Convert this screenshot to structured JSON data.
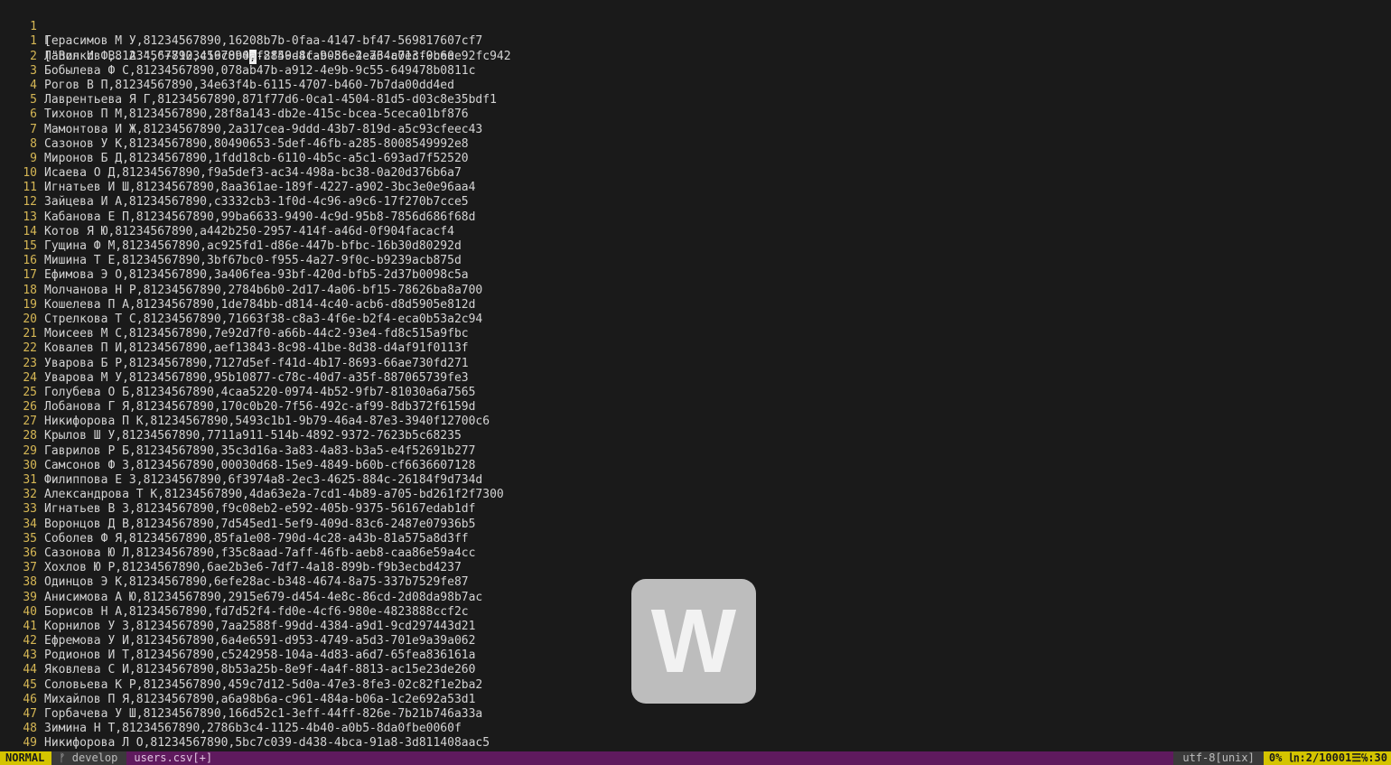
{
  "editor": {
    "first_line": {
      "number": "1",
      "text": "["
    },
    "current_line": {
      "number": "2",
      "text_before_cursor": "[\"Волков В. А.\",\"+71234567890",
      "cursor_char": ",",
      "text_after_cursor": "f8859d8c-905c-4e76-a013-0b6ae92fc942"
    },
    "lines": [
      {
        "n": "1",
        "t": "Герасимов М У,81234567890,16208b7b-0faa-4147-bf47-569817607cf7"
      },
      {
        "n": "2",
        "t": "Лапин И Ф,81234567890,c19c0b4a-2f40-4fab-86e2-a34c7ecf9ce0"
      },
      {
        "n": "3",
        "t": "Бобылева Ф С,81234567890,078ab47b-a912-4e9b-9c55-649478b0811c"
      },
      {
        "n": "4",
        "t": "Рогов В П,81234567890,34e63f4b-6115-4707-b460-7b7da00dd4ed"
      },
      {
        "n": "5",
        "t": "Лаврентьева Я Г,81234567890,871f77d6-0ca1-4504-81d5-d03c8e35bdf1"
      },
      {
        "n": "6",
        "t": "Тихонов П М,81234567890,28f8a143-db2e-415c-bcea-5ceca01bf876"
      },
      {
        "n": "7",
        "t": "Мамонтова И Ж,81234567890,2a317cea-9ddd-43b7-819d-a5c93cfeec43"
      },
      {
        "n": "8",
        "t": "Сазонов У К,81234567890,80490653-5def-46fb-a285-8008549992e8"
      },
      {
        "n": "9",
        "t": "Миронов Б Д,81234567890,1fdd18cb-6110-4b5c-a5c1-693ad7f52520"
      },
      {
        "n": "10",
        "t": "Исаева О Д,81234567890,f9a5def3-ac34-498a-bc38-0a20d376b6a7"
      },
      {
        "n": "11",
        "t": "Игнатьев И Ш,81234567890,8aa361ae-189f-4227-a902-3bc3e0e96aa4"
      },
      {
        "n": "12",
        "t": "Зайцева И А,81234567890,c3332cb3-1f0d-4c96-a9c6-17f270b7cce5"
      },
      {
        "n": "13",
        "t": "Кабанова Е П,81234567890,99ba6633-9490-4c9d-95b8-7856d686f68d"
      },
      {
        "n": "14",
        "t": "Котов Я Ю,81234567890,a442b250-2957-414f-a46d-0f904facacf4"
      },
      {
        "n": "15",
        "t": "Гущина Ф М,81234567890,ac925fd1-d86e-447b-bfbc-16b30d80292d"
      },
      {
        "n": "16",
        "t": "Мишина Т Е,81234567890,3bf67bc0-f955-4a27-9f0c-b9239acb875d"
      },
      {
        "n": "17",
        "t": "Ефимова Э О,81234567890,3a406fea-93bf-420d-bfb5-2d37b0098c5a"
      },
      {
        "n": "18",
        "t": "Молчанова Н Р,81234567890,2784b6b0-2d17-4a06-bf15-78626ba8a700"
      },
      {
        "n": "19",
        "t": "Кошелева П А,81234567890,1de784bb-d814-4c40-acb6-d8d5905e812d"
      },
      {
        "n": "20",
        "t": "Стрелкова Т С,81234567890,71663f38-c8a3-4f6e-b2f4-eca0b53a2c94"
      },
      {
        "n": "21",
        "t": "Моисеев М С,81234567890,7e92d7f0-a66b-44c2-93e4-fd8c515a9fbc"
      },
      {
        "n": "22",
        "t": "Ковалев П И,81234567890,aef13843-8c98-41be-8d38-d4af91f0113f"
      },
      {
        "n": "23",
        "t": "Уварова Б Р,81234567890,7127d5ef-f41d-4b17-8693-66ae730fd271"
      },
      {
        "n": "24",
        "t": "Уварова М У,81234567890,95b10877-c78c-40d7-a35f-887065739fe3"
      },
      {
        "n": "25",
        "t": "Голубева О Б,81234567890,4caa5220-0974-4b52-9fb7-81030a6a7565"
      },
      {
        "n": "26",
        "t": "Лобанова Г Я,81234567890,170c0b20-7f56-492c-af99-8db372f6159d"
      },
      {
        "n": "27",
        "t": "Никифорова П К,81234567890,5493c1b1-9b79-46a4-87e3-3940f12700c6"
      },
      {
        "n": "28",
        "t": "Крылов Ш У,81234567890,7711a911-514b-4892-9372-7623b5c68235"
      },
      {
        "n": "29",
        "t": "Гаврилов Р Б,81234567890,35c3d16a-3a83-4a83-b3a5-e4f52691b277"
      },
      {
        "n": "30",
        "t": "Самсонов Ф З,81234567890,00030d68-15e9-4849-b60b-cf6636607128"
      },
      {
        "n": "31",
        "t": "Филиппова Е З,81234567890,6f3974a8-2ec3-4625-884c-26184f9d734d"
      },
      {
        "n": "32",
        "t": "Александрова Т К,81234567890,4da63e2a-7cd1-4b89-a705-bd261f2f7300"
      },
      {
        "n": "33",
        "t": "Игнатьев В З,81234567890,f9c08eb2-e592-405b-9375-56167edab1df"
      },
      {
        "n": "34",
        "t": "Воронцов Д В,81234567890,7d545ed1-5ef9-409d-83c6-2487e07936b5"
      },
      {
        "n": "35",
        "t": "Соболев Ф Я,81234567890,85fa1e08-790d-4c28-a43b-81a575a8d3ff"
      },
      {
        "n": "36",
        "t": "Сазонова Ю Л,81234567890,f35c8aad-7aff-46fb-aeb8-caa86e59a4cc"
      },
      {
        "n": "37",
        "t": "Хохлов Ю Р,81234567890,6ae2b3e6-7df7-4a18-899b-f9b3ecbd4237"
      },
      {
        "n": "38",
        "t": "Одинцов Э К,81234567890,6efe28ac-b348-4674-8a75-337b7529fe87"
      },
      {
        "n": "39",
        "t": "Анисимова А Ю,81234567890,2915e679-d454-4e8c-86cd-2d08da98b7ac"
      },
      {
        "n": "40",
        "t": "Борисов Н А,81234567890,fd7d52f4-fd0e-4cf6-980e-4823888ccf2c"
      },
      {
        "n": "41",
        "t": "Корнилов У З,81234567890,7aa2588f-99dd-4384-a9d1-9cd297443d21"
      },
      {
        "n": "42",
        "t": "Ефремова У И,81234567890,6a4e6591-d953-4749-a5d3-701e9a39a062"
      },
      {
        "n": "43",
        "t": "Родионов И Т,81234567890,c5242958-104a-4d83-a6d7-65fea836161a"
      },
      {
        "n": "44",
        "t": "Яковлева С И,81234567890,8b53a25b-8e9f-4a4f-8813-ac15e23de260"
      },
      {
        "n": "45",
        "t": "Соловьева К Р,81234567890,459c7d12-5d0a-47e3-8fe3-02c82f1e2ba2"
      },
      {
        "n": "46",
        "t": "Михайлов П Я,81234567890,a6a98b6a-c961-484a-b06a-1c2e692a53d1"
      },
      {
        "n": "47",
        "t": "Горбачева У Ш,81234567890,166d52c1-3eff-44ff-826e-7b21b746a33a"
      },
      {
        "n": "48",
        "t": "Зимина Н Т,81234567890,2786b3c4-1125-4b40-a0b5-8da0fbe0060f"
      },
      {
        "n": "49",
        "t": "Никифорова Л О,81234567890,5bc7c039-d438-4bca-91a8-3d811408aac5"
      }
    ]
  },
  "watermark": {
    "letter": "W"
  },
  "statusline": {
    "mode": "NORMAL",
    "branch": "ᚠ develop",
    "filename": "users.csv[+]",
    "encoding": "utf-8[unix]",
    "position": "0% ㏑:2/10001☰℅:30"
  },
  "colors": {
    "background": "#1a1a1a",
    "line_number": "#d6b755",
    "statusline": "#5f1a5e",
    "mode_bg": "#d4c400"
  }
}
